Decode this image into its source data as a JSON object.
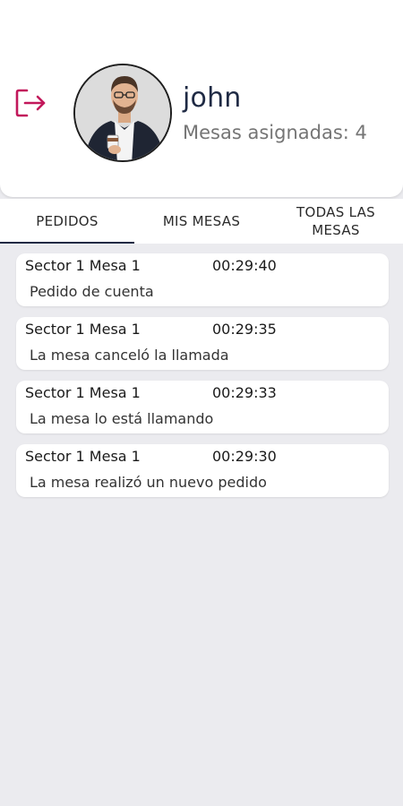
{
  "header": {
    "user_name": "john",
    "assigned_tables": "Mesas asignadas: 4",
    "logout_icon": "logout-icon",
    "accent_color": "#c2185b"
  },
  "tabs": [
    {
      "label": "PEDIDOS",
      "active": true
    },
    {
      "label": "MIS MESAS",
      "active": false
    },
    {
      "label": "TODAS LAS\nMESAS",
      "active": false
    }
  ],
  "notifications": [
    {
      "location": "Sector 1 Mesa 1",
      "time": "00:29:40",
      "message": "Pedido de cuenta"
    },
    {
      "location": "Sector 1 Mesa 1",
      "time": "00:29:35",
      "message": "La mesa canceló la llamada"
    },
    {
      "location": "Sector 1 Mesa 1",
      "time": "00:29:33",
      "message": "La mesa lo está llamando"
    },
    {
      "location": "Sector 1 Mesa 1",
      "time": "00:29:30",
      "message": "La mesa realizó un nuevo pedido"
    }
  ]
}
